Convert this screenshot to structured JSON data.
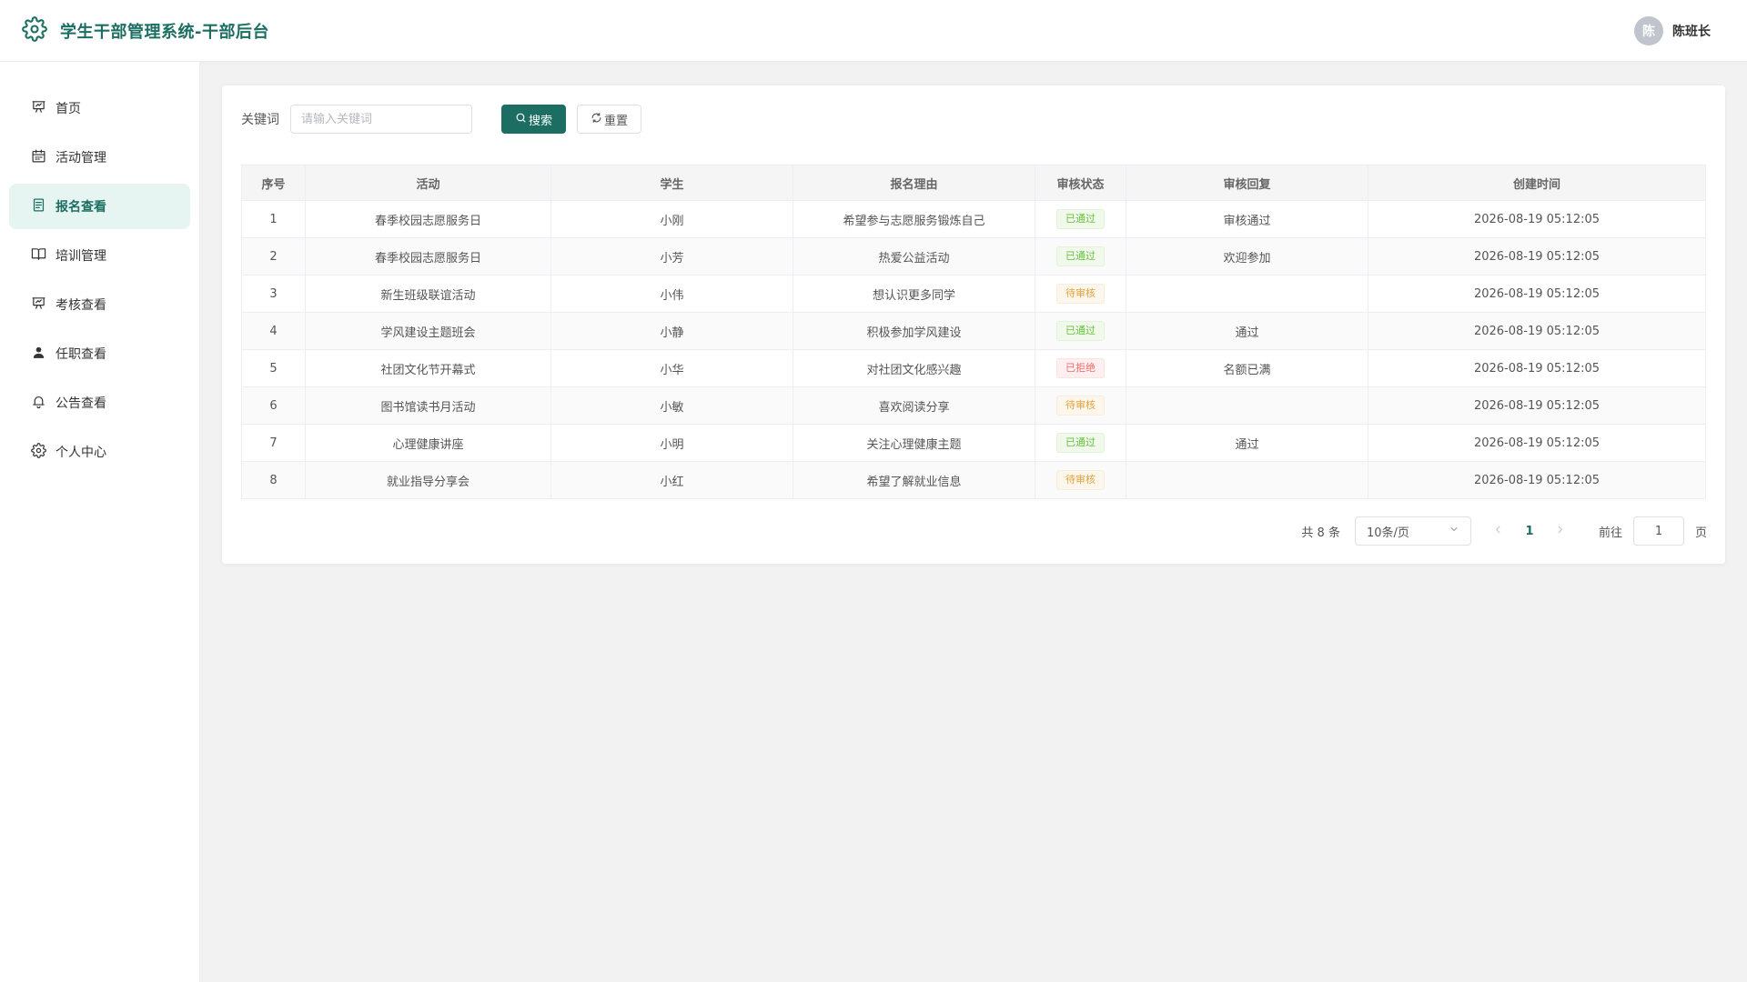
{
  "header": {
    "title": "学生干部管理系统-干部后台",
    "user_avatar_text": "陈",
    "user_name": "陈班长"
  },
  "sidebar": {
    "active_index": 2,
    "items": [
      {
        "label": "首页",
        "icon": "presentation-icon"
      },
      {
        "label": "活动管理",
        "icon": "calendar-icon"
      },
      {
        "label": "报名查看",
        "icon": "document-icon"
      },
      {
        "label": "培训管理",
        "icon": "book-icon"
      },
      {
        "label": "考核查看",
        "icon": "presentation-icon"
      },
      {
        "label": "任职查看",
        "icon": "user-icon"
      },
      {
        "label": "公告查看",
        "icon": "bell-icon"
      },
      {
        "label": "个人中心",
        "icon": "gear-icon"
      }
    ]
  },
  "search": {
    "label": "关键词",
    "placeholder": "请输入关键词",
    "value": "",
    "search_button": "搜索",
    "reset_button": "重置"
  },
  "table": {
    "columns": [
      "序号",
      "活动",
      "学生",
      "报名理由",
      "审核状态",
      "审核回复",
      "创建时间"
    ],
    "rows": [
      {
        "no": "1",
        "activity": "春季校园志愿服务日",
        "student": "小刚",
        "reason": "希望参与志愿服务锻炼自己",
        "status": "已通过",
        "reply": "审核通过",
        "created": "2026-08-19 05:12:05"
      },
      {
        "no": "2",
        "activity": "春季校园志愿服务日",
        "student": "小芳",
        "reason": "热爱公益活动",
        "status": "已通过",
        "reply": "欢迎参加",
        "created": "2026-08-19 05:12:05"
      },
      {
        "no": "3",
        "activity": "新生班级联谊活动",
        "student": "小伟",
        "reason": "想认识更多同学",
        "status": "待审核",
        "reply": "",
        "created": "2026-08-19 05:12:05"
      },
      {
        "no": "4",
        "activity": "学风建设主题班会",
        "student": "小静",
        "reason": "积极参加学风建设",
        "status": "已通过",
        "reply": "通过",
        "created": "2026-08-19 05:12:05"
      },
      {
        "no": "5",
        "activity": "社团文化节开幕式",
        "student": "小华",
        "reason": "对社团文化感兴趣",
        "status": "已拒绝",
        "reply": "名额已满",
        "created": "2026-08-19 05:12:05"
      },
      {
        "no": "6",
        "activity": "图书馆读书月活动",
        "student": "小敏",
        "reason": "喜欢阅读分享",
        "status": "待审核",
        "reply": "",
        "created": "2026-08-19 05:12:05"
      },
      {
        "no": "7",
        "activity": "心理健康讲座",
        "student": "小明",
        "reason": "关注心理健康主题",
        "status": "已通过",
        "reply": "通过",
        "created": "2026-08-19 05:12:05"
      },
      {
        "no": "8",
        "activity": "就业指导分享会",
        "student": "小红",
        "reason": "希望了解就业信息",
        "status": "待审核",
        "reply": "",
        "created": "2026-08-19 05:12:05"
      }
    ]
  },
  "status_colors": {
    "已通过": {
      "text": "#67c23a",
      "bg": "#f0f9eb",
      "border": "#e1f3d8"
    },
    "待审核": {
      "text": "#e6a23c",
      "bg": "#fdf6ec",
      "border": "#faecd8"
    },
    "已拒绝": {
      "text": "#f56c6c",
      "bg": "#fef0f0",
      "border": "#fde2e2"
    }
  },
  "pagination": {
    "total_text": "共 8 条",
    "page_size": "10条/页",
    "current_page": "1",
    "goto_label": "前往",
    "goto_value": "1",
    "page_suffix": "页"
  },
  "colors": {
    "primary": "#1c6e62",
    "active_nav_bg": "#e6f5f1"
  }
}
